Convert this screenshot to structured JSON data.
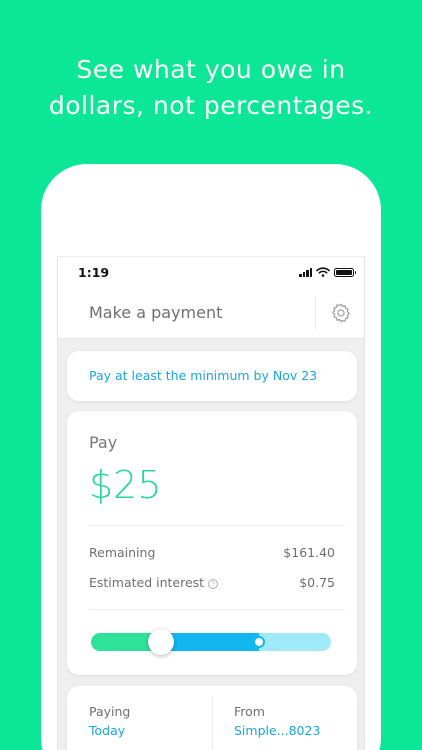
{
  "headline": {
    "line1": "See what you owe in",
    "line2": "dollars, not percentages."
  },
  "status_bar": {
    "time": "1:19"
  },
  "nav": {
    "title": "Make a payment",
    "settings_icon": "gear-icon"
  },
  "minimum_notice": {
    "text": "Pay at least the minimum by Nov 23"
  },
  "payment": {
    "label": "Pay",
    "amount": "$25",
    "remaining_label": "Remaining",
    "remaining_value": "$161.40",
    "interest_label": "Estimated interest",
    "interest_help_icon": "help-icon",
    "interest_help_glyph": "?",
    "interest_value": "$0.75",
    "slider": {
      "minimum_fraction": 0.29,
      "selected_fraction": 0.7
    }
  },
  "details": {
    "paying_label": "Paying",
    "paying_value": "Today",
    "from_label": "From",
    "from_value": "Simple...8023"
  },
  "colors": {
    "background": "#0ce697",
    "accent_blue": "#1aa6df",
    "amount_green": "#2ad79a",
    "slider_min": "#2ee29a",
    "slider_selected": "#12b7ef",
    "slider_rest": "#9feaf8"
  }
}
